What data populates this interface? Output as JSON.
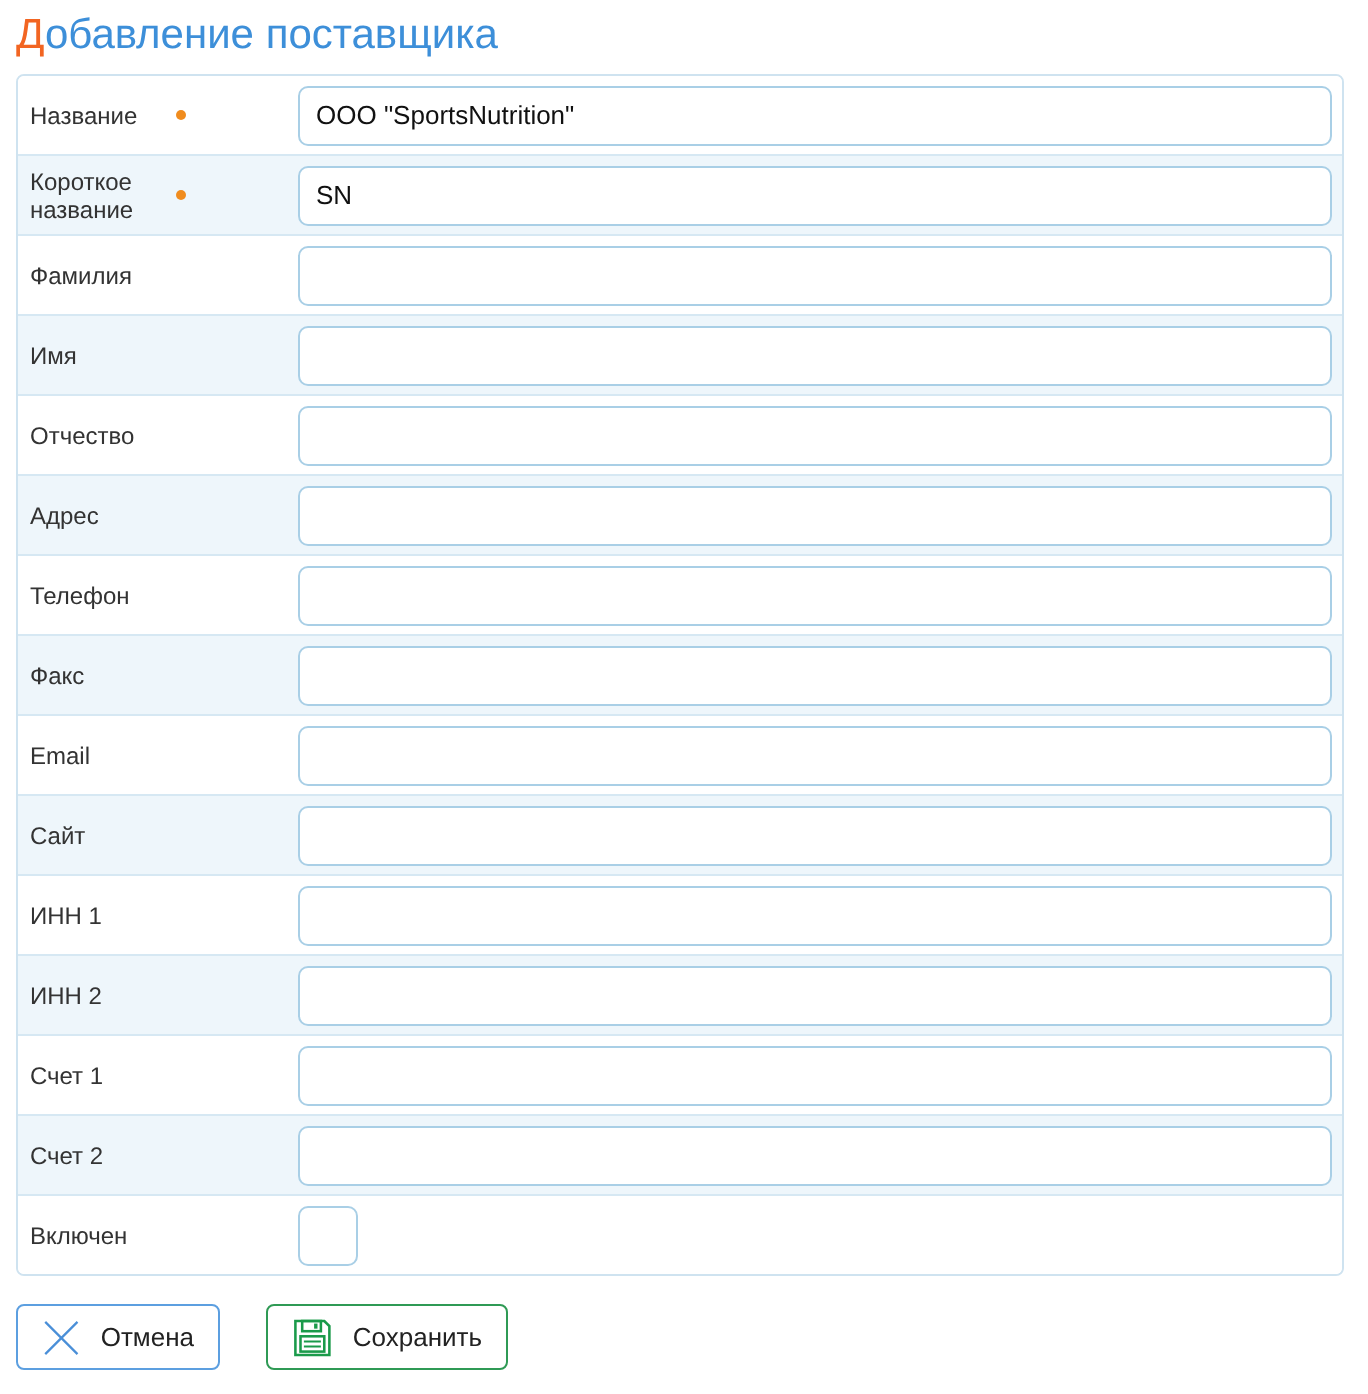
{
  "title": "Добавление поставщика",
  "fields": [
    {
      "label": "Название",
      "kind": "text",
      "required": true,
      "value": "ООО \"SportsNutrition\""
    },
    {
      "label": "Короткое название",
      "kind": "text",
      "required": true,
      "value": "SN"
    },
    {
      "label": "Фамилия",
      "kind": "text",
      "required": false
    },
    {
      "label": "Имя",
      "kind": "text",
      "required": false
    },
    {
      "label": "Отчество",
      "kind": "text",
      "required": false
    },
    {
      "label": "Адрес",
      "kind": "text",
      "required": false
    },
    {
      "label": "Телефон",
      "kind": "text",
      "required": false
    },
    {
      "label": "Факс",
      "kind": "text",
      "required": false
    },
    {
      "label": "Email",
      "kind": "text",
      "required": false
    },
    {
      "label": "Сайт",
      "kind": "text",
      "required": false
    },
    {
      "label": "ИНН 1",
      "kind": "text",
      "required": false
    },
    {
      "label": "ИНН 2",
      "kind": "text",
      "required": false
    },
    {
      "label": "Счет 1",
      "kind": "text",
      "required": false
    },
    {
      "label": "Счет 2",
      "kind": "text",
      "required": false
    },
    {
      "label": "Включен",
      "kind": "checkbox",
      "required": false,
      "checked": false
    }
  ],
  "buttons": [
    {
      "label": "Отмена",
      "kind": "cancel"
    },
    {
      "label": "Сохранить",
      "kind": "save"
    }
  ]
}
